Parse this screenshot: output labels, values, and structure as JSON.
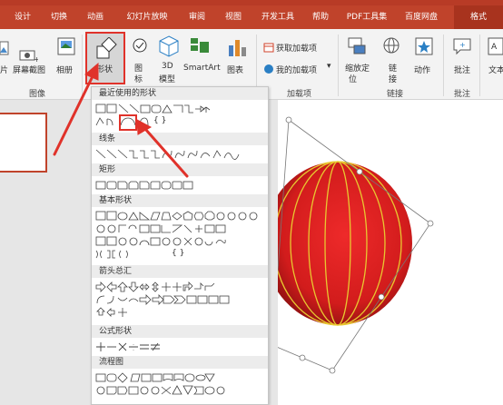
{
  "tabs": [
    "设计",
    "切换",
    "动画",
    "幻灯片放映",
    "审阅",
    "视图",
    "开发工具",
    "帮助",
    "PDF工具集",
    "百度网盘",
    "格式"
  ],
  "ribbon": {
    "pic_label": "片",
    "screenshot_label": "屏幕截图",
    "album_label": "相册",
    "group_image": "图像",
    "shapes_label": "形状",
    "icon_label_1": "图",
    "icon_label_2": "标",
    "model_label_1": "3D",
    "model_label_2": "模型",
    "smartart_label": "SmartArt",
    "chart_label": "图表",
    "get_addins": "获取加载项",
    "my_addins": "我的加载项",
    "group_addins": "加载项",
    "zoom_label_1": "缩放定",
    "zoom_label_2": "位",
    "link_label_1": "链",
    "link_label_2": "接",
    "action_label": "动作",
    "group_links": "链接",
    "comment_label": "批注",
    "group_comment": "批注",
    "text_label": "文本"
  },
  "dropdown": {
    "recent": "最近使用的形状",
    "lines": "线条",
    "rect": "矩形",
    "basic": "基本形状",
    "arrows": "箭头总汇",
    "equation": "公式形状",
    "flowchart": "流程图",
    "recent_glyphs": "{ }",
    "basic_glyphs": "{ }"
  },
  "colors": {
    "accent": "#c0432b",
    "highlight": "#e0322a",
    "lantern": "#d42020"
  }
}
